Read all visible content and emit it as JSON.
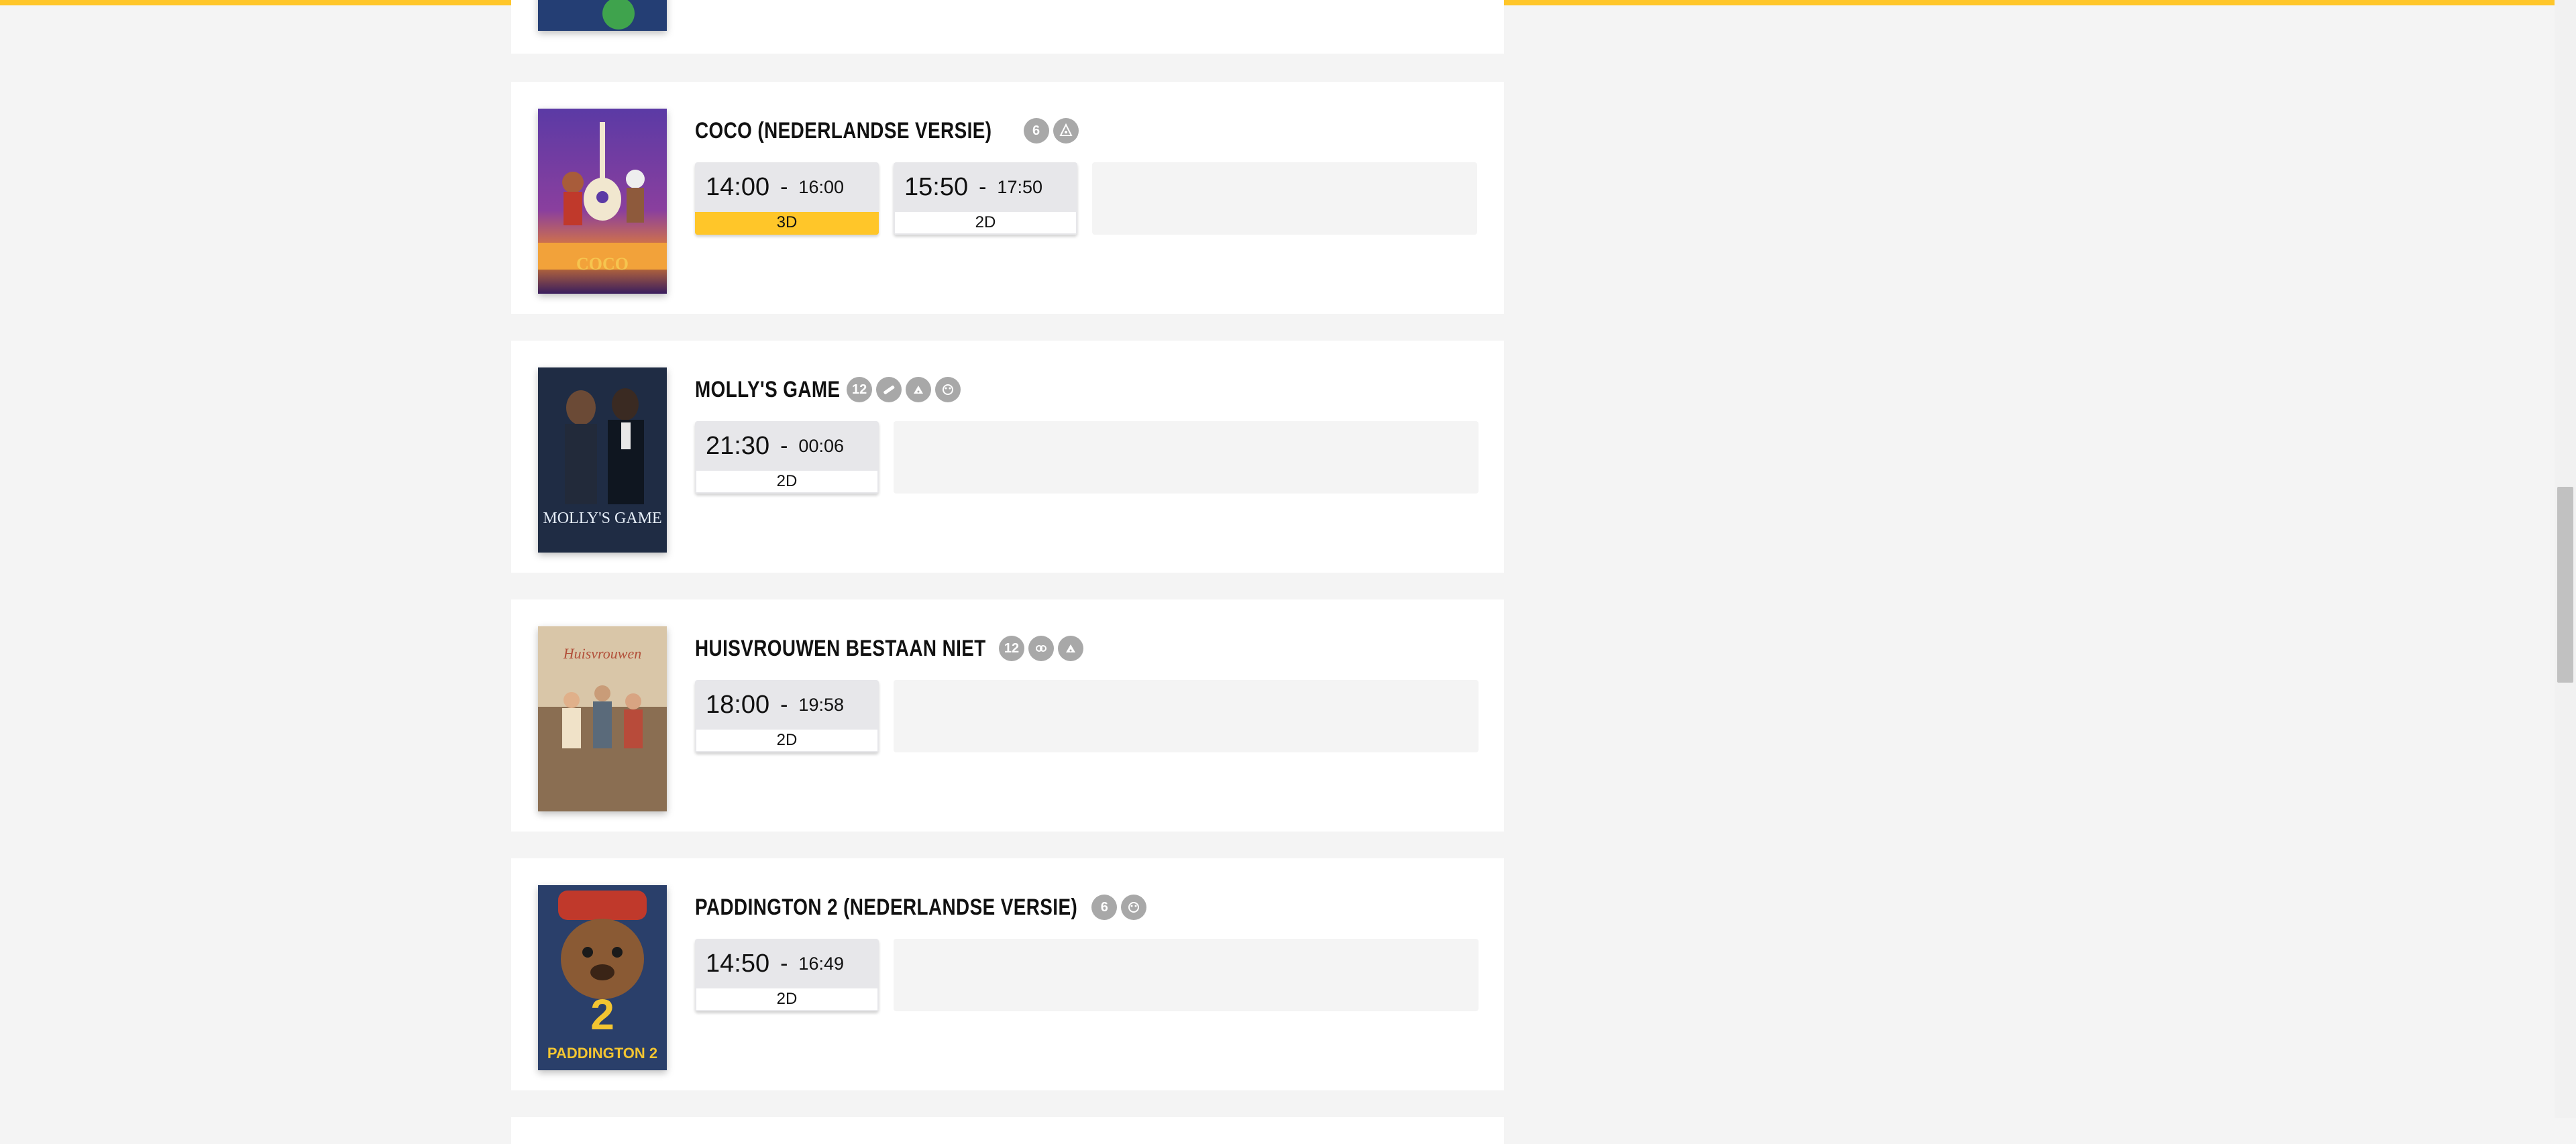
{
  "colors": {
    "accent": "#ffc629",
    "badge": "#a8a8a8"
  },
  "movies": [
    {
      "title": "COCO (NEDERLANDSE VERSIE)",
      "age_rating": "6",
      "content_icons": [
        "fear-icon"
      ],
      "showtimes": [
        {
          "start": "14:00",
          "sep": "-",
          "end": "16:00",
          "format": "3D"
        },
        {
          "start": "15:50",
          "sep": "-",
          "end": "17:50",
          "format": "2D"
        }
      ]
    },
    {
      "title": "MOLLY'S GAME",
      "age_rating": "12",
      "content_icons": [
        "drugs-icon",
        "coarse-language-icon",
        "discrimination-icon"
      ],
      "showtimes": [
        {
          "start": "21:30",
          "sep": "-",
          "end": "00:06",
          "format": "2D"
        }
      ]
    },
    {
      "title": "HUISVROUWEN BESTAAN NIET",
      "age_rating": "12",
      "content_icons": [
        "sex-icon",
        "coarse-language-icon"
      ],
      "showtimes": [
        {
          "start": "18:00",
          "sep": "-",
          "end": "19:58",
          "format": "2D"
        }
      ]
    },
    {
      "title": "PADDINGTON 2 (NEDERLANDSE VERSIE)",
      "age_rating": "6",
      "content_icons": [
        "discrimination-icon"
      ],
      "showtimes": [
        {
          "start": "14:50",
          "sep": "-",
          "end": "16:49",
          "format": "2D"
        }
      ]
    }
  ]
}
